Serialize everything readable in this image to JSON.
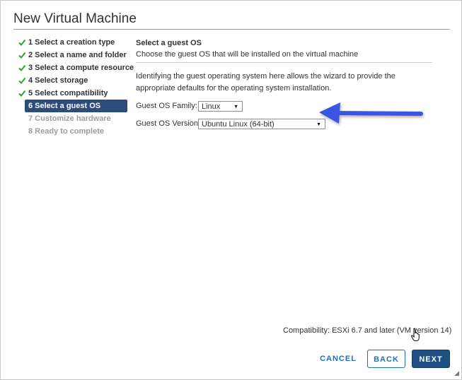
{
  "dialog": {
    "title": "New Virtual Machine"
  },
  "steps": [
    {
      "label": "1 Select a creation type",
      "state": "done"
    },
    {
      "label": "2 Select a name and folder",
      "state": "done"
    },
    {
      "label": "3 Select a compute resource",
      "state": "done"
    },
    {
      "label": "4 Select storage",
      "state": "done"
    },
    {
      "label": "5 Select compatibility",
      "state": "done"
    },
    {
      "label": "6 Select a guest OS",
      "state": "active"
    },
    {
      "label": "7 Customize hardware",
      "state": "pending"
    },
    {
      "label": "8 Ready to complete",
      "state": "pending"
    }
  ],
  "main": {
    "heading": "Select a guest OS",
    "subheading": "Choose the guest OS that will be installed on the virtual machine",
    "description": "Identifying the guest operating system here allows the wizard to provide the appropriate defaults for the operating system installation.",
    "os_family": {
      "label": "Guest OS Family:",
      "value": "Linux"
    },
    "os_version": {
      "label": "Guest OS Version:",
      "value": "Ubuntu Linux (64-bit)"
    }
  },
  "footer": {
    "compatibility": "Compatibility: ESXi 6.7 and later (VM version 14)",
    "cancel_label": "CANCEL",
    "back_label": "BACK",
    "next_label": "NEXT"
  },
  "colors": {
    "accent": "#1a73b8",
    "active_step_bg": "#2c4d7a",
    "check_green": "#3a9a3a",
    "annotation_arrow": "#3b55e0"
  },
  "icons": {
    "done": "check-icon",
    "arrow": "annotation-arrow",
    "cursor": "hand-pointer-icon"
  }
}
